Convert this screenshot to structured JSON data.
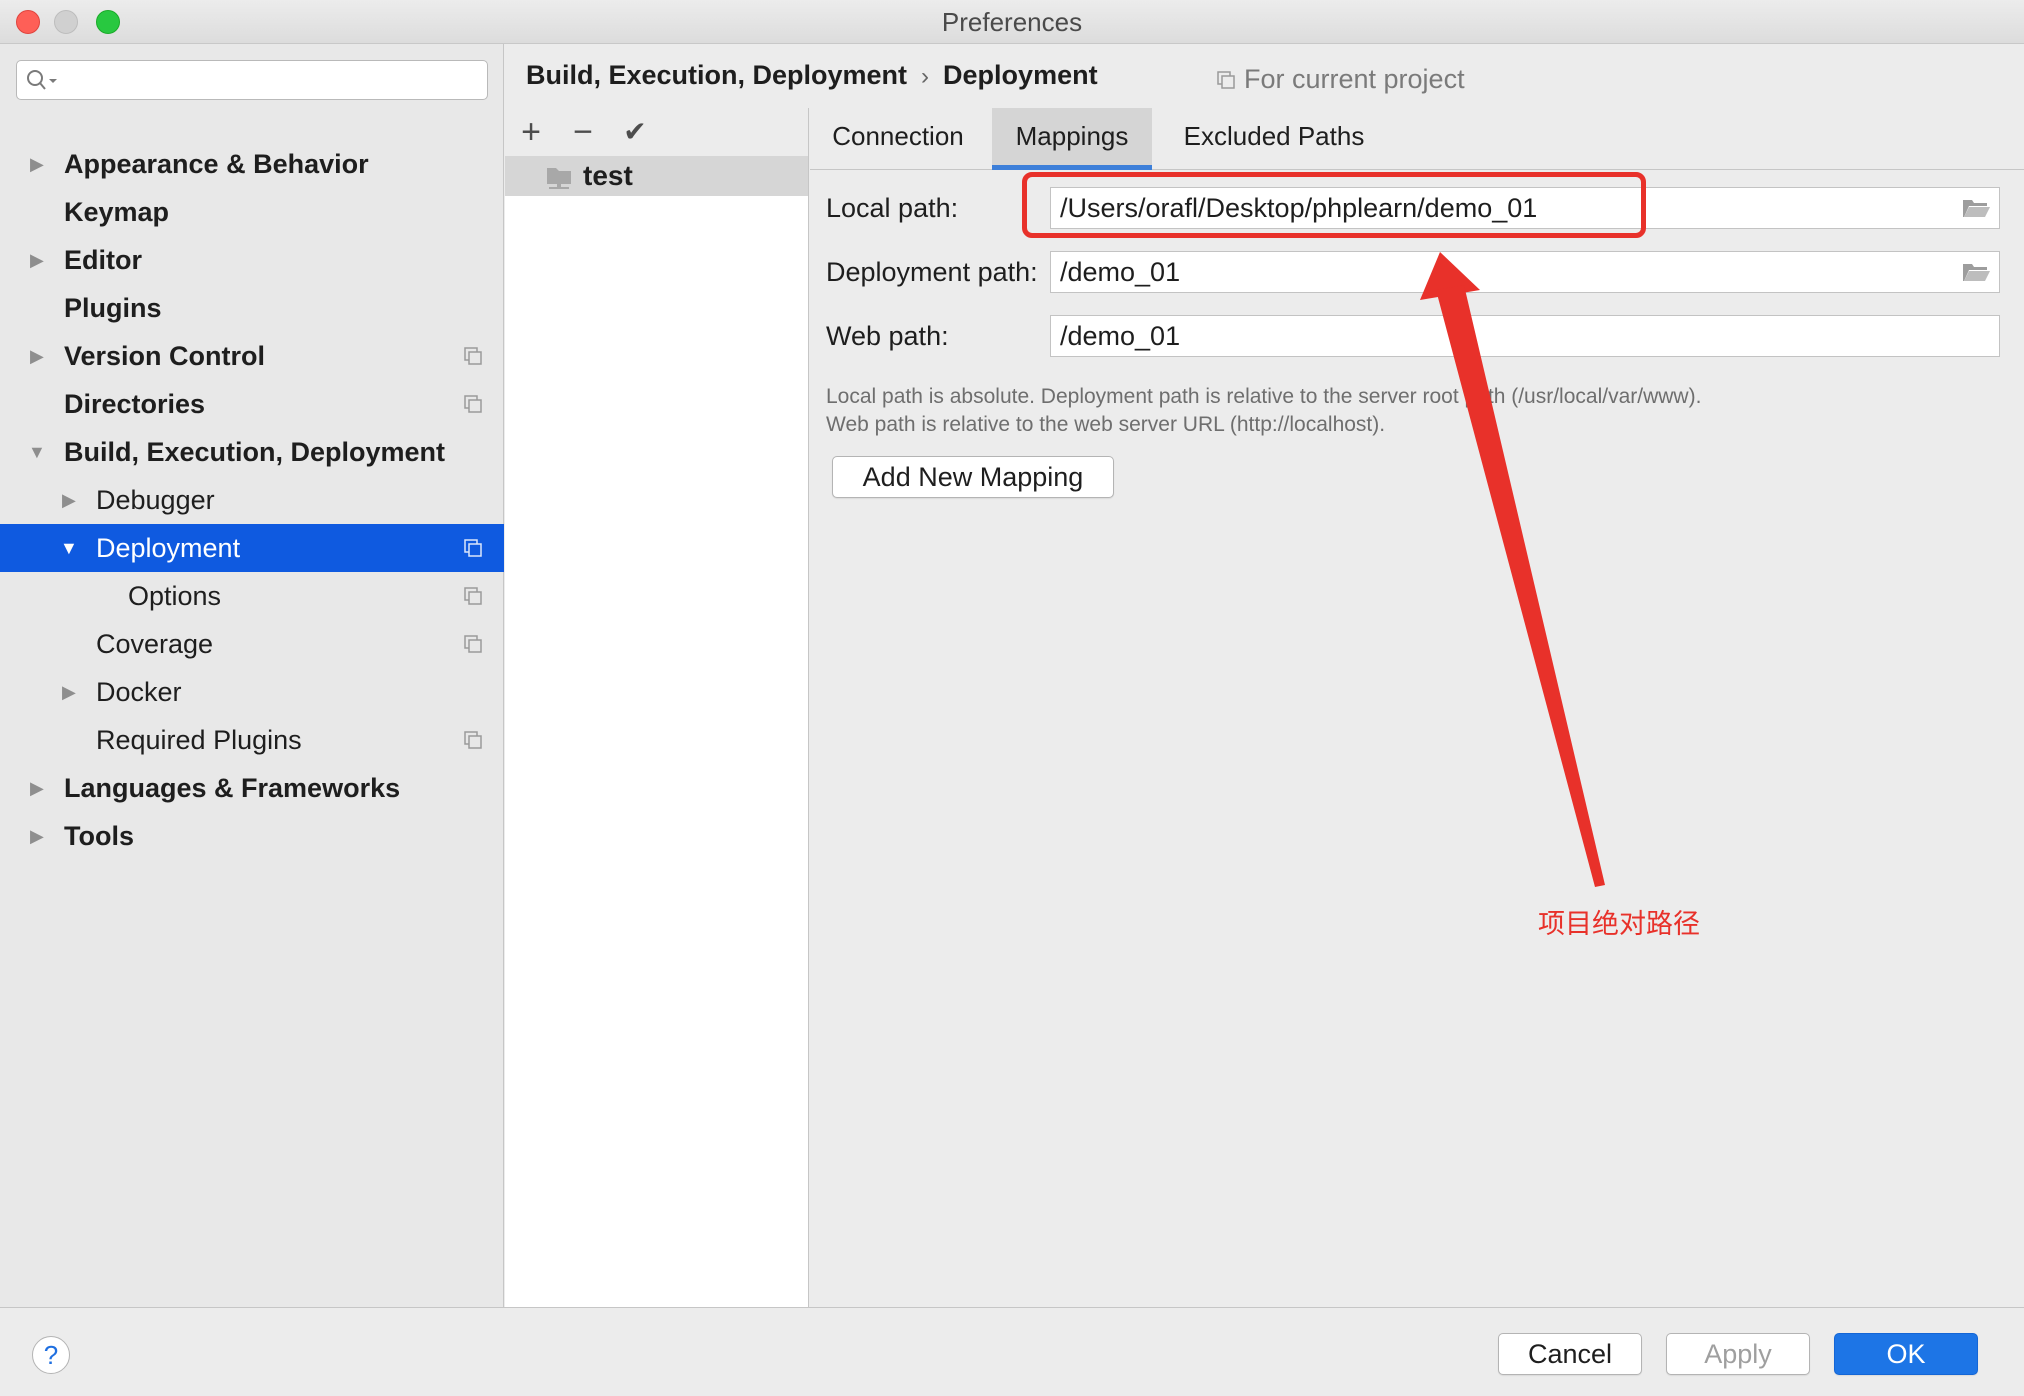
{
  "window": {
    "title": "Preferences"
  },
  "search": {
    "placeholder": "",
    "value": ""
  },
  "sidebar": {
    "items": [
      {
        "label": "Appearance & Behavior",
        "expandable": true,
        "expanded": false,
        "bold": true
      },
      {
        "label": "Keymap",
        "expandable": false,
        "bold": true
      },
      {
        "label": "Editor",
        "expandable": true,
        "expanded": false,
        "bold": true
      },
      {
        "label": "Plugins",
        "expandable": false,
        "bold": true
      },
      {
        "label": "Version Control",
        "expandable": true,
        "expanded": false,
        "bold": true,
        "project_scope": true
      },
      {
        "label": "Directories",
        "expandable": false,
        "bold": true,
        "project_scope": true
      },
      {
        "label": "Build, Execution, Deployment",
        "expandable": true,
        "expanded": true,
        "bold": true
      },
      {
        "label": "Debugger",
        "expandable": true,
        "expanded": false
      },
      {
        "label": "Deployment",
        "expandable": true,
        "expanded": true,
        "selected": true,
        "project_scope": true
      },
      {
        "label": "Options",
        "project_scope": true
      },
      {
        "label": "Coverage",
        "project_scope": true
      },
      {
        "label": "Docker",
        "expandable": true,
        "expanded": false
      },
      {
        "label": "Required Plugins",
        "project_scope": true
      },
      {
        "label": "Languages & Frameworks",
        "expandable": true,
        "expanded": false,
        "bold": true
      },
      {
        "label": "Tools",
        "expandable": true,
        "expanded": false,
        "bold": true
      }
    ]
  },
  "header": {
    "breadcrumb_parent": "Build, Execution, Deployment",
    "breadcrumb_separator": "›",
    "breadcrumb_current": "Deployment",
    "scope_label": "For current project"
  },
  "servers": {
    "tools": {
      "add": "+",
      "remove": "−",
      "default": "✔"
    },
    "items": [
      {
        "name": "test"
      }
    ]
  },
  "tabs": [
    {
      "label": "Connection",
      "active": false
    },
    {
      "label": "Mappings",
      "active": true
    },
    {
      "label": "Excluded Paths",
      "active": false
    }
  ],
  "mappings": {
    "local_path_label": "Local path:",
    "local_path_value": "/Users/orafl/Desktop/phplearn/demo_01",
    "deployment_path_label": "Deployment path:",
    "deployment_path_value": "/demo_01",
    "web_path_label": "Web path:",
    "web_path_value": "/demo_01",
    "hint_line1": "Local path is absolute. Deployment path is relative to the server root path (/usr/local/var/www).",
    "hint_line2": "Web path is relative to the web server URL (http://localhost).",
    "add_mapping_button": "Add New Mapping"
  },
  "annotation": {
    "text": "项目绝对路径",
    "color": "#e8312a"
  },
  "footer": {
    "help": "?",
    "cancel": "Cancel",
    "apply": "Apply",
    "ok": "OK"
  },
  "colors": {
    "selection": "#0f5ae0",
    "ok_button": "#1d75e6",
    "tab_underline": "#3d7fd9"
  }
}
